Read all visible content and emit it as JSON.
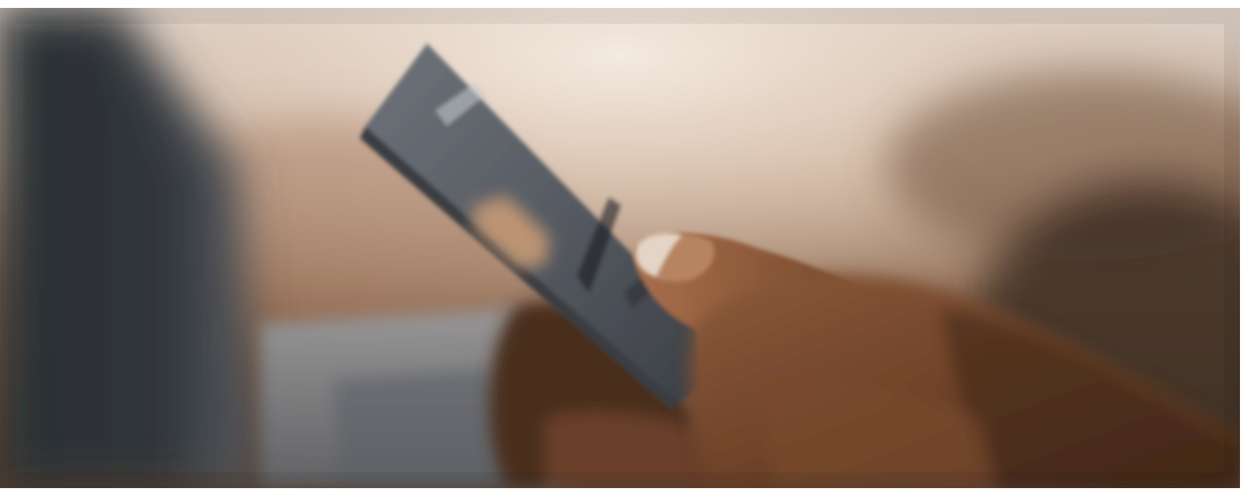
{
  "photo": {
    "subject": "",
    "palette": {
      "laptop_dark": "#2f3338",
      "laptop_mid": "#4a4f55",
      "background_warm": "#8a6a52",
      "background_light": "#e8ddd2",
      "card": "#5e636a",
      "card_edge": "#3a3e43",
      "card_stripe": "#b8906e",
      "skin_dark": "#5a3722",
      "skin_mid": "#7a4c30",
      "skin_light": "#a06a48",
      "nail": "#e6d6c8"
    }
  }
}
